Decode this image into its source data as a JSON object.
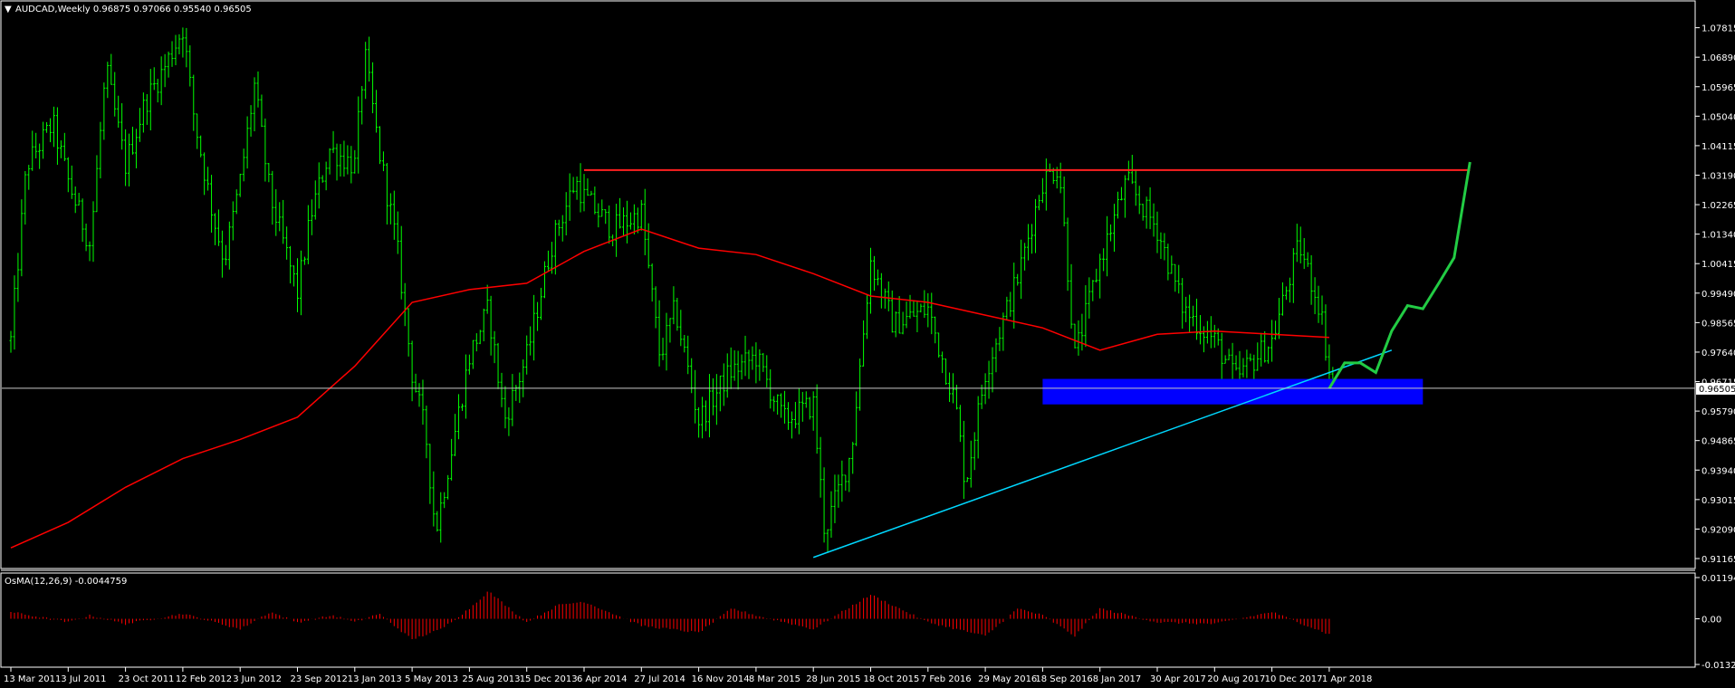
{
  "header": {
    "symbol_info": "AUDCAD,Weekly  0.96875 0.97066 0.95540 0.96505",
    "indicator_info": "OsMA(12,26,9) -0.0044759"
  },
  "current_price_label": "0.96505",
  "colors": {
    "background": "#000000",
    "bull_bar": "#00ff00",
    "moving_average": "#ff0000",
    "resistance": "#ff2020",
    "support_zone": "#0000ff",
    "trendline": "#00d8ff",
    "projection": "#22cc44",
    "osma_bar": "#ff0000",
    "price_line": "#c8c8c8"
  },
  "chart_data": [
    {
      "type": "candlestick",
      "title": "AUDCAD,Weekly",
      "ylim": [
        0.91165,
        1.084
      ],
      "y_ticks": [
        "1.07815",
        "1.06890",
        "1.05965",
        "1.05040",
        "1.04115",
        "1.03190",
        "1.02265",
        "1.01340",
        "1.00415",
        "0.99490",
        "0.98565",
        "0.97640",
        "0.96715",
        "0.95790",
        "0.94865",
        "0.93940",
        "0.93015",
        "0.92090",
        "0.91165"
      ],
      "x_ticks": [
        "13 Mar 2011",
        "3 Jul 2011",
        "23 Oct 2011",
        "12 Feb 2012",
        "3 Jun 2012",
        "23 Sep 2012",
        "13 Jan 2013",
        "5 May 2013",
        "25 Aug 2013",
        "15 Dec 2013",
        "6 Apr 2014",
        "27 Jul 2014",
        "16 Nov 2014",
        "8 Mar 2015",
        "28 Jun 2015",
        "18 Oct 2015",
        "7 Feb 2016",
        "29 May 2016",
        "18 Sep 2016",
        "8 Jan 2017",
        "30 Apr 2017",
        "20 Aug 2017",
        "10 Dec 2017",
        "1 Apr 2018"
      ],
      "price_path": [
        [
          "13 Mar 2011",
          0.98
        ],
        [
          "13 Apr 2011",
          1.035
        ],
        [
          "3 Jun 2011",
          1.048
        ],
        [
          "3 Jul 2011",
          1.03
        ],
        [
          "15 Aug 2011",
          1.01
        ],
        [
          "15 Sep 2011",
          1.065
        ],
        [
          "23 Oct 2011",
          1.035
        ],
        [
          "1 Dec 2011",
          1.055
        ],
        [
          "5 Jan 2012",
          1.065
        ],
        [
          "12 Feb 2012",
          1.078
        ],
        [
          "5 Mar 2012",
          1.05
        ],
        [
          "10 Apr 2012",
          1.02
        ],
        [
          "3 May 2012",
          1.005
        ],
        [
          "3 Jun 2012",
          1.03
        ],
        [
          "1 Jul 2012",
          1.06
        ],
        [
          "1 Aug 2012",
          1.025
        ],
        [
          "23 Sep 2012",
          0.995
        ],
        [
          "20 Oct 2012",
          1.02
        ],
        [
          "25 Nov 2012",
          1.04
        ],
        [
          "13 Jan 2013",
          1.035
        ],
        [
          "1 Feb 2013",
          1.07
        ],
        [
          "1 Mar 2013",
          1.04
        ],
        [
          "5 Apr 2013",
          1.01
        ],
        [
          "5 May 2013",
          0.97
        ],
        [
          "1 Jun 2013",
          0.95
        ],
        [
          "20 Jun 2013",
          0.92
        ],
        [
          "25 Aug 2013",
          0.975
        ],
        [
          "1 Oct 2013",
          0.99
        ],
        [
          "1 Nov 2013",
          0.955
        ],
        [
          "15 Dec 2013",
          0.975
        ],
        [
          "1 Feb 2014",
          1.01
        ],
        [
          "20 Mar 2014",
          1.03
        ],
        [
          "6 Apr 2014",
          1.025
        ],
        [
          "1 Jun 2014",
          1.015
        ],
        [
          "27 Jul 2014",
          1.02
        ],
        [
          "1 Sep 2014",
          0.975
        ],
        [
          "1 Oct 2014",
          0.99
        ],
        [
          "16 Nov 2014",
          0.955
        ],
        [
          "15 Jan 2015",
          0.97
        ],
        [
          "8 Mar 2015",
          0.975
        ],
        [
          "1 May 2015",
          0.955
        ],
        [
          "28 Jun 2015",
          0.96
        ],
        [
          "20 Jul 2015",
          0.92
        ],
        [
          "10 Sep 2015",
          0.945
        ],
        [
          "18 Oct 2015",
          1.005
        ],
        [
          "1 Dec 2015",
          0.985
        ],
        [
          "7 Feb 2016",
          0.99
        ],
        [
          "1 Apr 2016",
          0.96
        ],
        [
          "20 Apr 2016",
          0.935
        ],
        [
          "29 May 2016",
          0.97
        ],
        [
          "1 Aug 2016",
          1.0
        ],
        [
          "18 Sep 2016",
          1.03
        ],
        [
          "20 Oct 2016",
          1.035
        ],
        [
          "20 Nov 2016",
          0.975
        ],
        [
          "8 Jan 2017",
          1.005
        ],
        [
          "1 Mar 2017",
          1.03
        ],
        [
          "30 Apr 2017",
          1.015
        ],
        [
          "20 Jun 2017",
          0.99
        ],
        [
          "20 Aug 2017",
          0.98
        ],
        [
          "1 Oct 2017",
          0.968
        ],
        [
          "10 Dec 2017",
          0.98
        ],
        [
          "1 Feb 2018",
          1.01
        ],
        [
          "15 Mar 2018",
          0.99
        ],
        [
          "1 Apr 2018",
          0.97
        ],
        [
          "10 Apr 2018",
          0.965
        ]
      ],
      "series": [
        {
          "name": "",
          "style": "moving-average",
          "values": [
            [
              "13 Mar 2011",
              0.915
            ],
            [
              "3 Jul 2011",
              0.923
            ],
            [
              "23 Oct 2011",
              0.934
            ],
            [
              "12 Feb 2012",
              0.943
            ],
            [
              "3 Jun 2012",
              0.949
            ],
            [
              "23 Sep 2012",
              0.956
            ],
            [
              "13 Jan 2013",
              0.972
            ],
            [
              "5 May 2013",
              0.992
            ],
            [
              "25 Aug 2013",
              0.996
            ],
            [
              "15 Dec 2013",
              0.998
            ],
            [
              "6 Apr 2014",
              1.008
            ],
            [
              "27 Jul 2014",
              1.015
            ],
            [
              "16 Nov 2014",
              1.009
            ],
            [
              "8 Mar 2015",
              1.007
            ],
            [
              "28 Jun 2015",
              1.001
            ],
            [
              "18 Oct 2015",
              0.994
            ],
            [
              "7 Feb 2016",
              0.992
            ],
            [
              "29 May 2016",
              0.988
            ],
            [
              "18 Sep 2016",
              0.984
            ],
            [
              "8 Jan 2017",
              0.977
            ],
            [
              "30 Apr 2017",
              0.982
            ],
            [
              "20 Aug 2017",
              0.983
            ],
            [
              "10 Dec 2017",
              0.982
            ],
            [
              "1 Apr 2018",
              0.981
            ]
          ]
        }
      ],
      "annotations": {
        "resistance_line": {
          "from": "6 Apr 2014",
          "to": "1 Jan 2019",
          "price": 1.0335
        },
        "support_zone": {
          "from": "18 Sep 2016",
          "to": "1 Oct 2018",
          "price_top": 0.968,
          "price_bottom": 0.96
        },
        "trendline": {
          "from": [
            "28 Jun 2015",
            0.912
          ],
          "to": [
            "1 Aug 2018",
            0.977
          ]
        },
        "projection_path": [
          [
            "1 Apr 2018",
            0.965
          ],
          [
            "1 May 2018",
            0.973
          ],
          [
            "1 Jun 2018",
            0.973
          ],
          [
            "1 Jul 2018",
            0.97
          ],
          [
            "1 Aug 2018",
            0.983
          ],
          [
            "1 Sep 2018",
            0.991
          ],
          [
            "1 Oct 2018",
            0.99
          ],
          [
            "1 Nov 2018",
            0.998
          ],
          [
            "1 Dec 2018",
            1.006
          ],
          [
            "1 Jan 2019",
            1.036
          ]
        ],
        "current_price": 0.96505
      }
    },
    {
      "type": "histogram",
      "title": "OsMA(12,26,9) -0.0044759",
      "ylim": [
        -0.013231,
        0.011949
      ],
      "y_ticks": [
        "0.011949",
        "0.00",
        "-0.013231"
      ],
      "values_path": [
        [
          "13 Mar 2011",
          0.002
        ],
        [
          "3 Jul 2011",
          -0.001
        ],
        [
          "15 Aug 2011",
          0.001
        ],
        [
          "23 Oct 2011",
          -0.0015
        ],
        [
          "12 Feb 2012",
          0.0015
        ],
        [
          "3 Jun 2012",
          -0.003
        ],
        [
          "1 Aug 2012",
          0.002
        ],
        [
          "23 Sep 2012",
          -0.001
        ],
        [
          "1 Dec 2012",
          0.001
        ],
        [
          "13 Jan 2013",
          -0.001
        ],
        [
          "1 Mar 2013",
          0.0015
        ],
        [
          "5 May 2013",
          -0.006
        ],
        [
          "1 Jul 2013",
          -0.003
        ],
        [
          "25 Aug 2013",
          0.003
        ],
        [
          "1 Oct 2013",
          0.008
        ],
        [
          "15 Dec 2013",
          -0.001
        ],
        [
          "15 Feb 2014",
          0.004
        ],
        [
          "6 Apr 2014",
          0.005
        ],
        [
          "27 Jul 2014",
          -0.002
        ],
        [
          "16 Nov 2014",
          -0.004
        ],
        [
          "20 Jan 2015",
          0.003
        ],
        [
          "8 Mar 2015",
          0.001
        ],
        [
          "28 Jun 2015",
          -0.003
        ],
        [
          "18 Oct 2015",
          0.007
        ],
        [
          "7 Feb 2016",
          -0.001
        ],
        [
          "29 May 2016",
          -0.005
        ],
        [
          "1 Aug 2016",
          0.003
        ],
        [
          "18 Sep 2016",
          0.001
        ],
        [
          "20 Nov 2016",
          -0.005
        ],
        [
          "8 Jan 2017",
          0.003
        ],
        [
          "30 Apr 2017",
          -0.001
        ],
        [
          "20 Aug 2017",
          -0.0015
        ],
        [
          "10 Dec 2017",
          0.002
        ],
        [
          "1 Apr 2018",
          -0.0045
        ]
      ]
    }
  ]
}
